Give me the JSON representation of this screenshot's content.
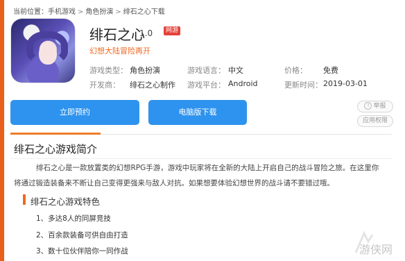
{
  "breadcrumb": {
    "prefix": "当前位置：",
    "items": [
      "手机游戏",
      "角色扮演",
      "绯石之心下载"
    ],
    "separator": ">"
  },
  "game": {
    "title": "绯石之心",
    "version": "1.0",
    "badge": "网游",
    "subtitle": "幻想大陆冒险再开",
    "icon": "game-cover-art"
  },
  "info": {
    "row1": [
      {
        "label": "游戏类型：",
        "value": "角色扮演"
      },
      {
        "label": "游戏语言：",
        "value": "中文"
      },
      {
        "label": "价格：",
        "value": "免费"
      }
    ],
    "row2": [
      {
        "label": "开发商：",
        "value": "绯石之心制作"
      },
      {
        "label": "游戏平台：",
        "value": "Android"
      },
      {
        "label": "更新时间：",
        "value": "2019-03-01"
      }
    ]
  },
  "actions": {
    "reserve": "立即预约",
    "pc_download": "电脑版下载",
    "report": "举报",
    "permissions": "应用权限"
  },
  "intro": {
    "heading": "绯石之心游戏简介",
    "line1": "绯石之心是一款放置类的幻想RPG手游，游戏中玩家将在全新的大陆上开启自己的战斗冒险之旅。在这里你",
    "line2": "将通过锻造装备来不断让自己变得更强来与敌人对抗。如果想要体验幻想世界的战斗请不要错过哦。"
  },
  "features": {
    "heading": "绯石之心游戏特色",
    "items": [
      "1、多达8人的同屏竞技",
      "2、百余款装备可供自由打造",
      "3、数十位伙伴陪你一同作战"
    ]
  },
  "watermark": "游侠网",
  "colors": {
    "accent": "#ef6a22",
    "button": "#2e93ee",
    "badge": "#e5423a"
  }
}
